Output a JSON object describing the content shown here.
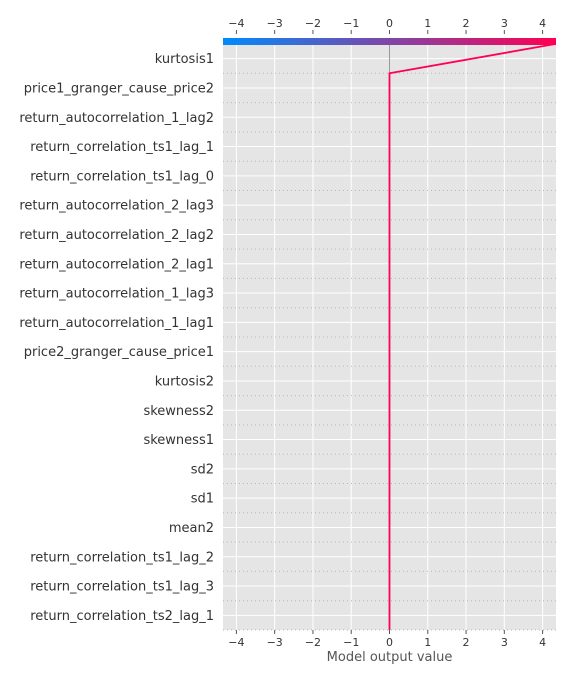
{
  "chart_data": {
    "type": "line",
    "chart_kind": "shap-decision-plot",
    "xlabel": "Model output value",
    "xlim": [
      -4.35,
      4.35
    ],
    "x_ticks": [
      -4,
      -3,
      -2,
      -1,
      0,
      1,
      2,
      3,
      4
    ],
    "x_tick_labels": [
      "−4",
      "−3",
      "−2",
      "−1",
      "0",
      "1",
      "2",
      "3",
      "4"
    ],
    "base_value": 0,
    "grid": true,
    "background": "#e5e5e5",
    "colorbar": {
      "position": "top",
      "range": [
        -4.35,
        4.35
      ],
      "colors": [
        "#008bfb",
        "#ff0052"
      ]
    },
    "features": [
      "kurtosis1",
      "price1_granger_cause_price2",
      "return_autocorrelation_1_lag2",
      "return_correlation_ts1_lag_1",
      "return_correlation_ts1_lag_0",
      "return_autocorrelation_2_lag3",
      "return_autocorrelation_2_lag2",
      "return_autocorrelation_2_lag1",
      "return_autocorrelation_1_lag3",
      "return_autocorrelation_1_lag1",
      "price2_granger_cause_price1",
      "kurtosis2",
      "skewness2",
      "skewness1",
      "sd2",
      "sd1",
      "mean2",
      "return_correlation_ts1_lag_2",
      "return_correlation_ts1_lag_3",
      "return_correlation_ts2_lag_1"
    ],
    "series": [
      {
        "color": "#ff0052",
        "values": [
          4.33,
          0.0,
          0.0,
          0.0,
          0.0,
          0.0,
          0.0,
          0.0,
          0.0,
          0.0,
          0.0,
          0.0,
          0.0,
          0.0,
          0.0,
          0.0,
          0.0,
          0.0,
          0.0,
          0.0,
          0.0
        ]
      }
    ]
  }
}
